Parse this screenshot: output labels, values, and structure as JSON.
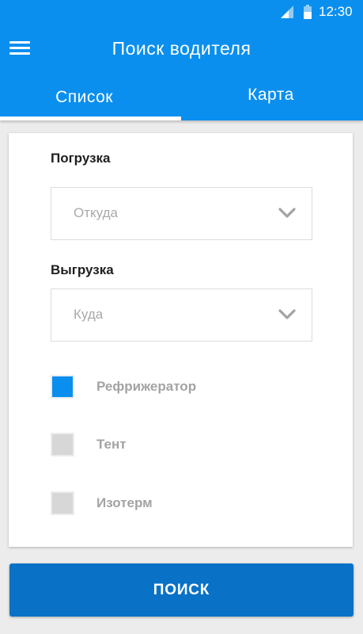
{
  "status_bar": {
    "time": "12:30",
    "icons": [
      "signal-icon",
      "battery-icon"
    ]
  },
  "app_bar": {
    "title": "Поиск водителя",
    "menu_icon": "hamburger-menu-icon"
  },
  "tabs": [
    {
      "label": "Список",
      "selected": true
    },
    {
      "label": "Карта",
      "selected": false
    }
  ],
  "form": {
    "loading": {
      "label": "Погрузка",
      "placeholder": "Откуда"
    },
    "unloading": {
      "label": "Выгрузка",
      "placeholder": "Куда"
    },
    "body_types": [
      {
        "label": "Рефрижератор",
        "checked": true
      },
      {
        "label": "Тент",
        "checked": false
      },
      {
        "label": "Изотерм",
        "checked": false
      }
    ]
  },
  "search_button": {
    "label": "ПОИСК"
  },
  "colors": {
    "primary": "#0a8fef",
    "button": "#0a72c6",
    "checkbox_checked": "#0a8fef",
    "checkbox_unchecked": "#d7d7d7",
    "background": "#ececec"
  }
}
